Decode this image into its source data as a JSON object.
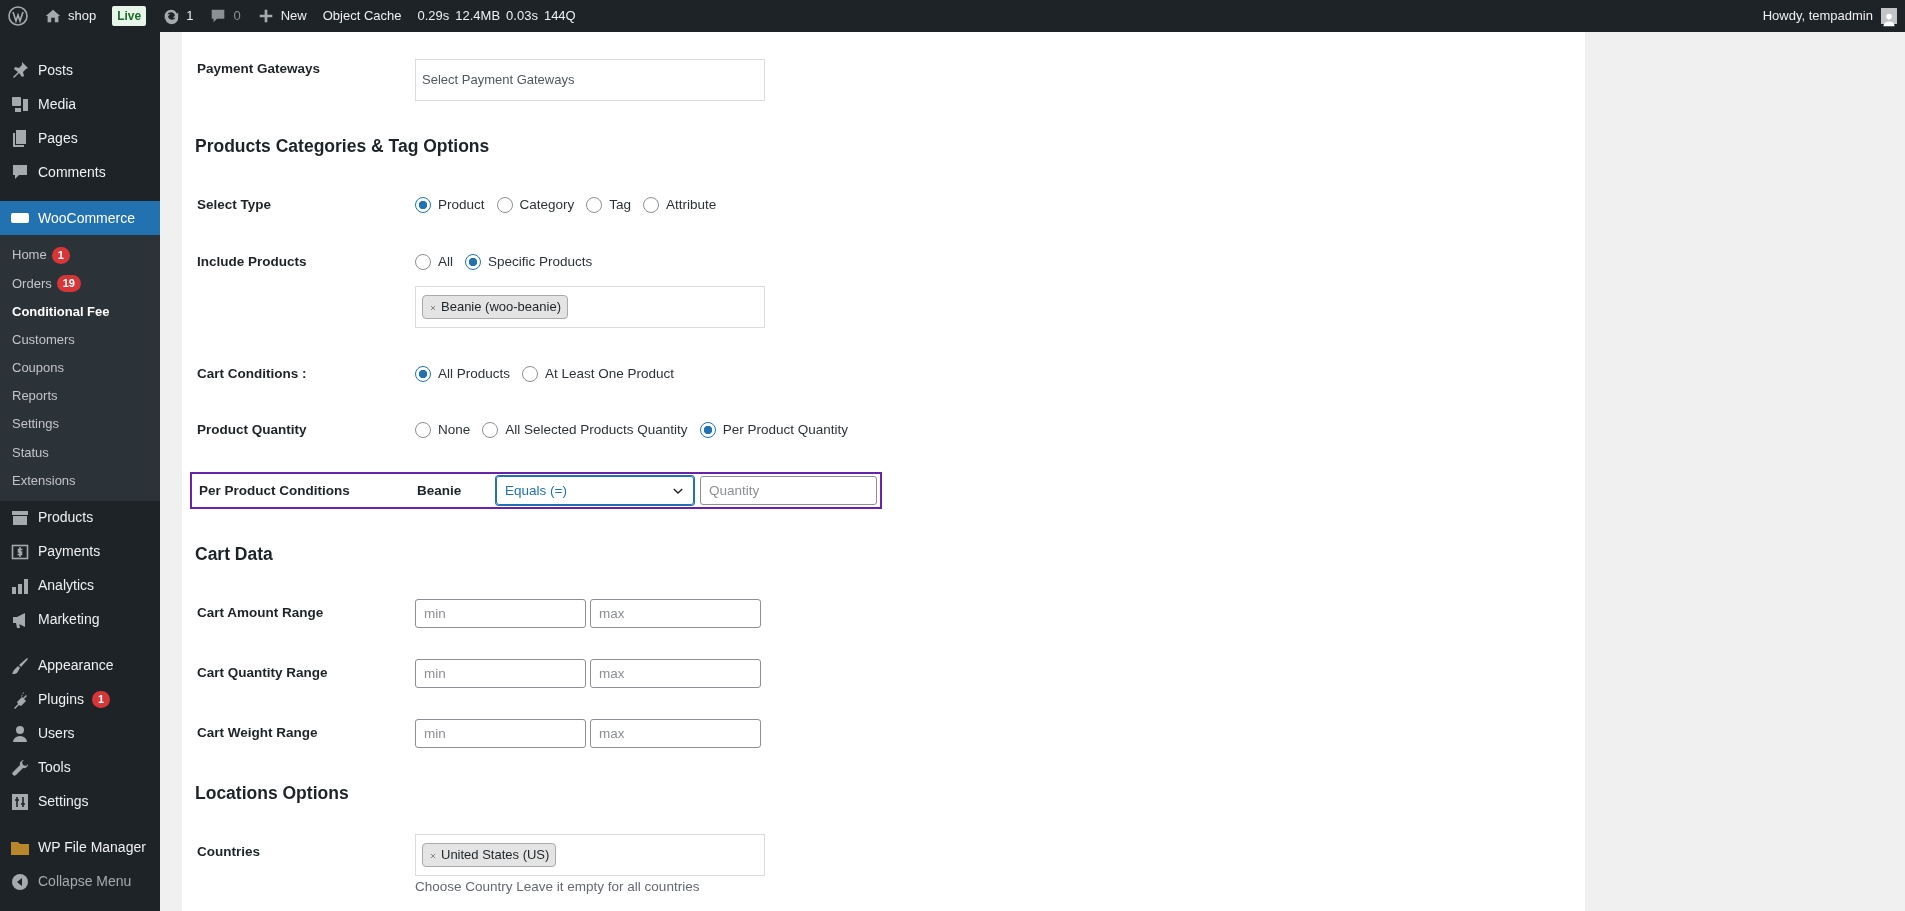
{
  "admin_bar": {
    "site_name": "shop",
    "live_badge": "Live",
    "updates_count": "1",
    "comments_count": "0",
    "new_label": "New",
    "object_cache": "Object Cache",
    "stats": [
      "0.29s",
      "12.4MB",
      "0.03s",
      "144Q"
    ],
    "greeting": "Howdy, tempadmin"
  },
  "sidebar": {
    "items": [
      {
        "label": "Posts",
        "selected": false
      },
      {
        "label": "Media",
        "selected": false
      },
      {
        "label": "Pages",
        "selected": false
      },
      {
        "label": "Comments",
        "selected": false
      },
      {
        "label": "WooCommerce",
        "selected": true,
        "children": [
          {
            "label": "Home",
            "badge": "1",
            "selected": false
          },
          {
            "label": "Orders",
            "badge": "19",
            "selected": false
          },
          {
            "label": "Conditional Fee",
            "selected": true
          },
          {
            "label": "Customers",
            "selected": false
          },
          {
            "label": "Coupons",
            "selected": false
          },
          {
            "label": "Reports",
            "selected": false
          },
          {
            "label": "Settings",
            "selected": false
          },
          {
            "label": "Status",
            "selected": false
          },
          {
            "label": "Extensions",
            "selected": false
          }
        ]
      },
      {
        "label": "Products",
        "selected": false
      },
      {
        "label": "Payments",
        "selected": false
      },
      {
        "label": "Analytics",
        "selected": false
      },
      {
        "label": "Marketing",
        "selected": false
      },
      {
        "label": "Appearance",
        "selected": false
      },
      {
        "label": "Plugins",
        "badge": "1",
        "selected": false
      },
      {
        "label": "Users",
        "selected": false
      },
      {
        "label": "Tools",
        "selected": false
      },
      {
        "label": "Settings",
        "selected": false
      },
      {
        "label": "WP File Manager",
        "selected": false
      },
      {
        "label": "Collapse Menu",
        "selected": false
      }
    ]
  },
  "form": {
    "rows": [
      {
        "kind": "select",
        "label": "Payment Gateways",
        "placeholder": "Select Payment Gateways"
      },
      {
        "kind": "heading",
        "label": "Products Categories & Tag Options"
      },
      {
        "kind": "radios",
        "label": "Select Type",
        "options": [
          {
            "label": "Product",
            "selected": true
          },
          {
            "label": "Category",
            "selected": false
          },
          {
            "label": "Tag",
            "selected": false
          },
          {
            "label": "Attribute",
            "selected": false
          }
        ]
      },
      {
        "kind": "radios",
        "label": "Include Products",
        "options": [
          {
            "label": "All",
            "selected": false
          },
          {
            "label": "Specific Products",
            "selected": true
          }
        ],
        "tags": [
          "Beanie (woo-beanie)"
        ]
      },
      {
        "kind": "radios",
        "label": "Cart Conditions :",
        "options": [
          {
            "label": "All Products",
            "selected": true
          },
          {
            "label": "At Least One Product",
            "selected": false
          }
        ]
      },
      {
        "kind": "radios",
        "label": "Product Quantity",
        "options": [
          {
            "label": "None",
            "selected": false
          },
          {
            "label": "All Selected Products Quantity",
            "selected": false
          },
          {
            "label": "Per Product Quantity",
            "selected": true
          }
        ]
      },
      {
        "kind": "condition",
        "label": "Per Product Conditions",
        "product": "Beanie",
        "operator": "Equals (=)",
        "placeholder": "Quantity",
        "highlighted": true
      },
      {
        "kind": "heading",
        "label": "Cart Data"
      },
      {
        "kind": "range",
        "label": "Cart Amount Range",
        "min_placeholder": "min",
        "max_placeholder": "max"
      },
      {
        "kind": "range",
        "label": "Cart Quantity Range",
        "min_placeholder": "min",
        "max_placeholder": "max"
      },
      {
        "kind": "range",
        "label": "Cart Weight Range",
        "min_placeholder": "min",
        "max_placeholder": "max"
      },
      {
        "kind": "heading",
        "label": "Locations Options"
      },
      {
        "kind": "tags",
        "label": "Countries",
        "tags": [
          "United States (US)"
        ],
        "help": "Choose Country Leave it empty for all countries"
      }
    ]
  }
}
